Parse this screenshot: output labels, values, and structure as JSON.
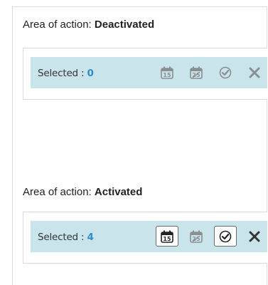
{
  "sections": [
    {
      "caption_prefix": "Area of action: ",
      "caption_state": "Deactivated",
      "selected_label": "Selected : ",
      "selected_count": "0",
      "active": false
    },
    {
      "caption_prefix": "Area of action: ",
      "caption_state": "Activated",
      "selected_label": "Selected : ",
      "selected_count": "4",
      "active": true
    }
  ],
  "icons": {
    "calendar_day": "calendar-15-icon",
    "calendar_range": "calendar-25-icon",
    "checkmark": "checkmark-circle-icon",
    "tools": "wrench-icon"
  },
  "colors": {
    "bar_background": "#c9e4ea",
    "count_color": "#2a8fcf",
    "icon_active": "#222222",
    "icon_inactive": "#8a8f92"
  }
}
